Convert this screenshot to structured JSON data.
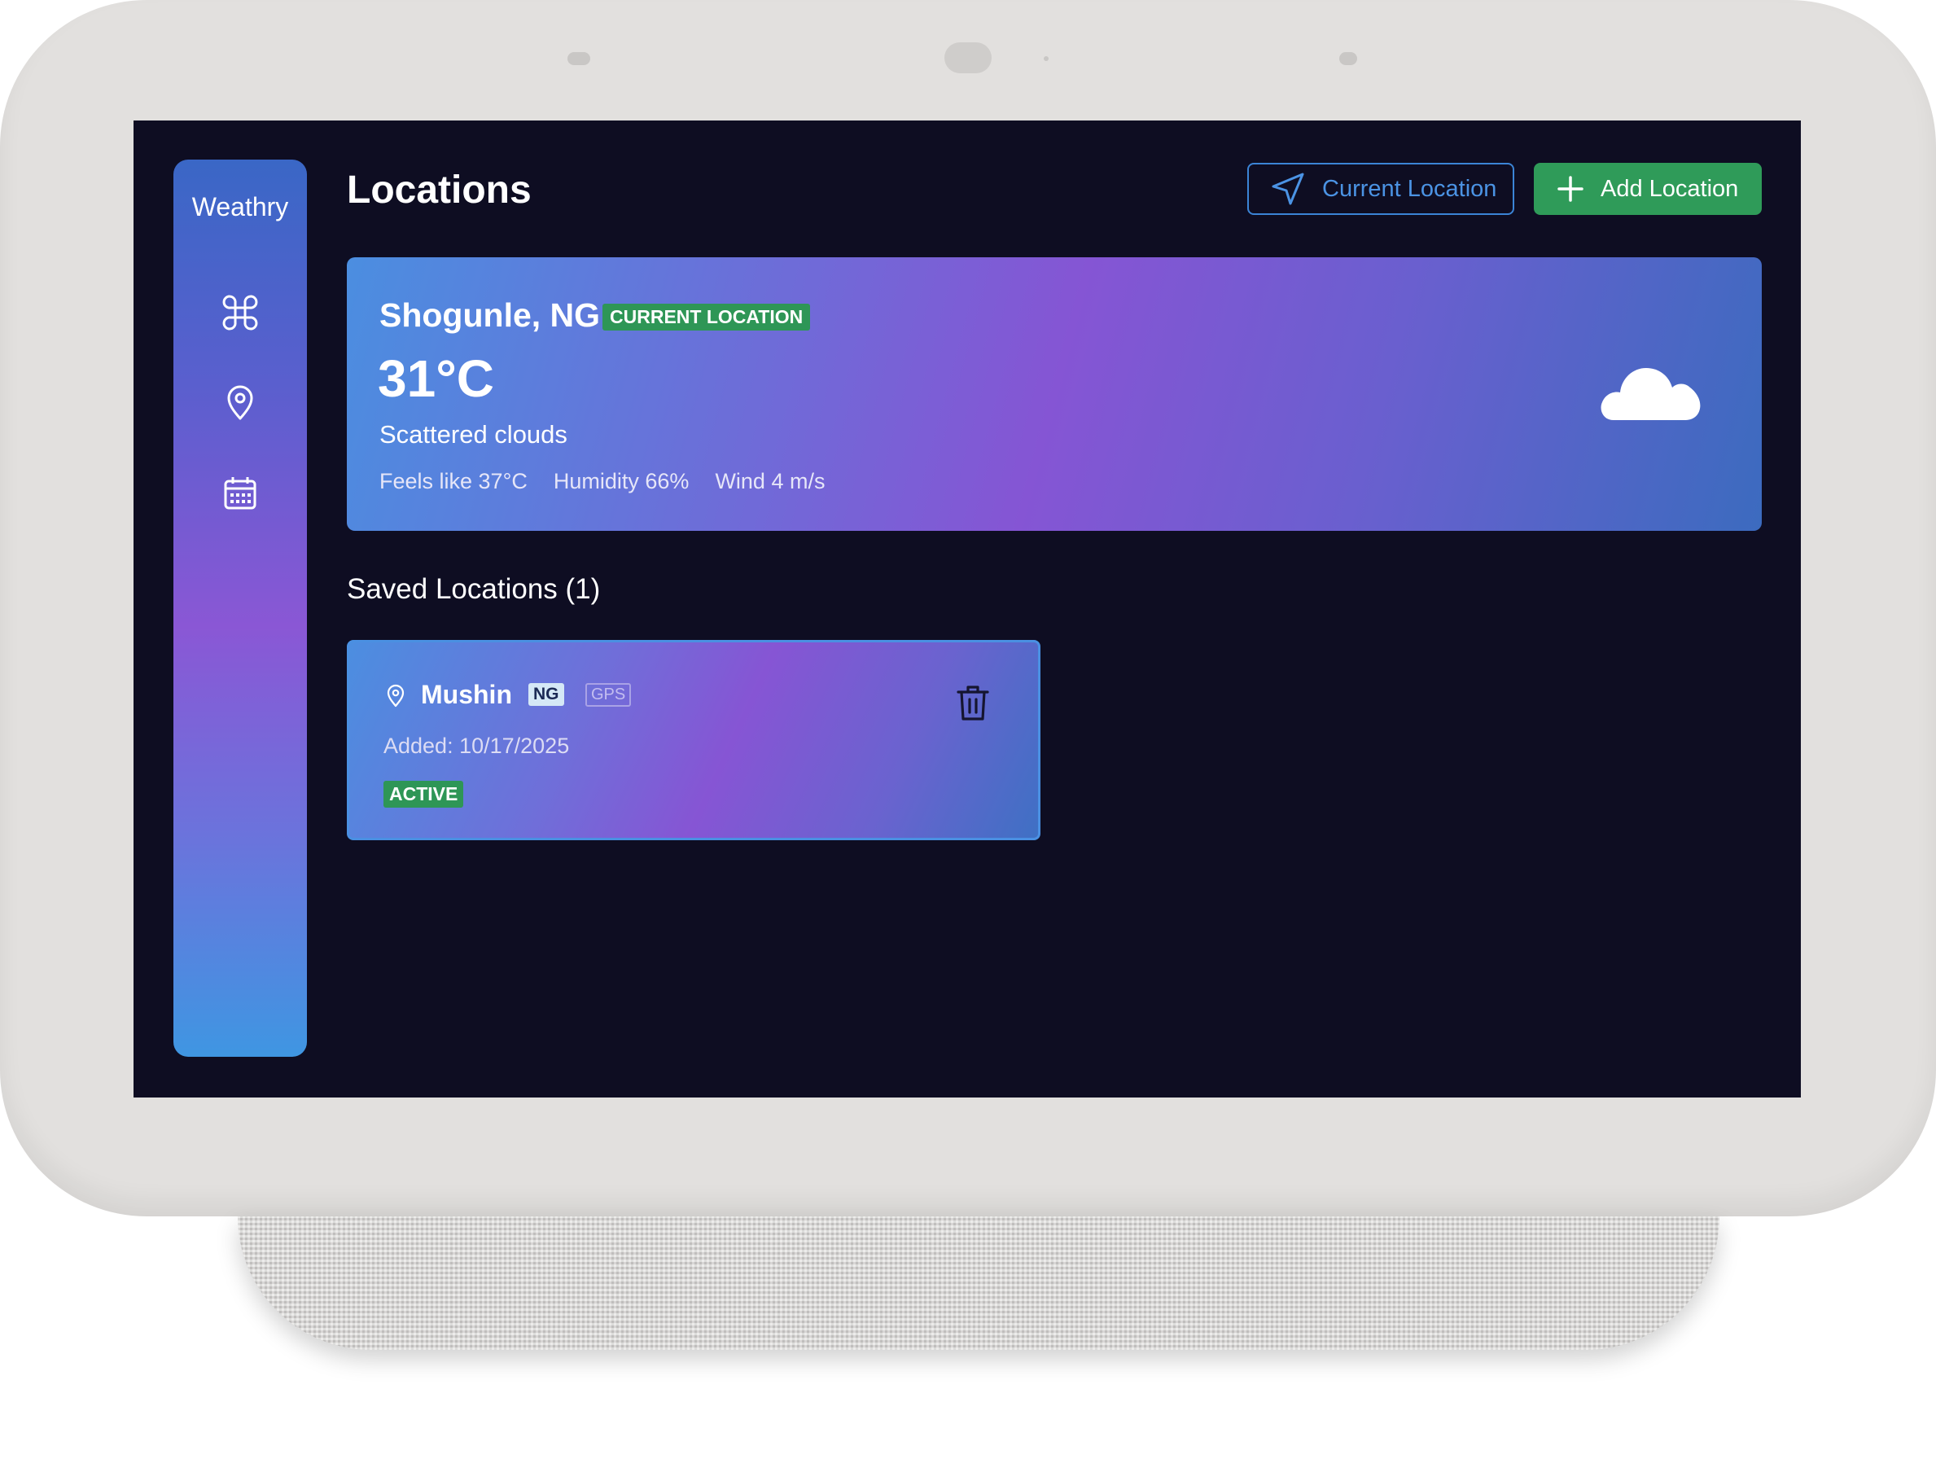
{
  "app": {
    "name": "Weathry"
  },
  "header": {
    "title": "Locations",
    "current_location_label": "Current Location",
    "add_location_label": "Add Location"
  },
  "sidebar": {
    "items": [
      {
        "icon": "dashboard-icon"
      },
      {
        "icon": "location-pin-icon"
      },
      {
        "icon": "calendar-icon"
      }
    ]
  },
  "current_weather": {
    "city": "Shogunle, NG",
    "badge": "CURRENT LOCATION",
    "temperature": "31°C",
    "description": "Scattered clouds",
    "feels_like": "Feels like 37°C",
    "humidity": "Humidity 66%",
    "wind": "Wind 4 m/s",
    "icon": "cloud-icon"
  },
  "saved": {
    "heading": "Saved Locations (1)",
    "locations": [
      {
        "name": "Mushin",
        "country": "NG",
        "source": "GPS",
        "added": "Added: 10/17/2025",
        "status": "ACTIVE"
      }
    ]
  },
  "colors": {
    "screen_bg": "#0e0d22",
    "accent_green": "#2f9b59",
    "accent_blue": "#4b93e4",
    "gradient_purple": "#8555d4"
  }
}
